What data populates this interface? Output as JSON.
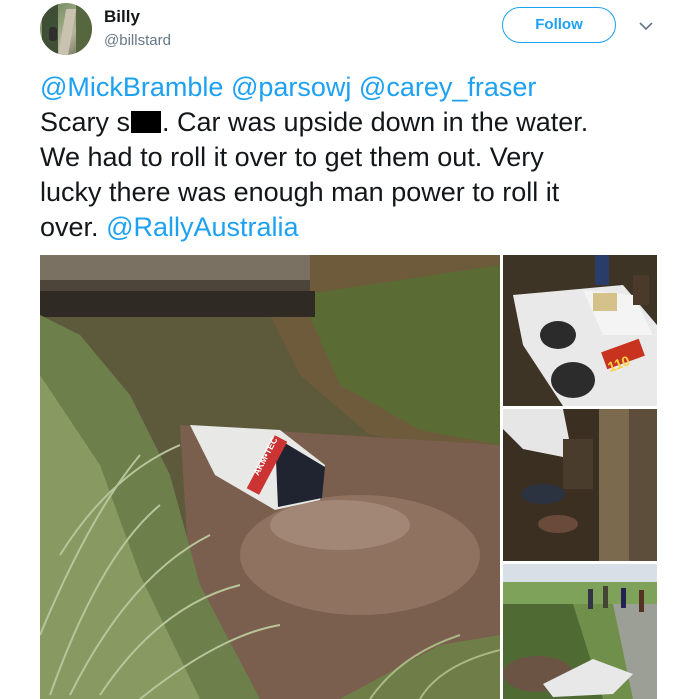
{
  "user": {
    "name": "Billy",
    "handle": "@billstard",
    "follow_label": "Follow"
  },
  "tweet": {
    "mentions": [
      "@MickBramble",
      "@parsowj",
      "@carey_fraser"
    ],
    "line1_prefix": "Scary s",
    "line1_suffix": ". Car was upside down in the water.",
    "line2": "We had to roll it over to get them out. Very",
    "line3": "lucky there was enough man power to roll it",
    "line4_prefix": "over.",
    "hashtag_mention": "@RallyAustralia"
  },
  "photos": {
    "main_car_decal": "AKM•TEC",
    "car_number": "110"
  },
  "colors": {
    "accent": "#1da1f2",
    "text": "#14171a",
    "muted": "#657786"
  },
  "icons": [
    "chevron-down-icon"
  ]
}
